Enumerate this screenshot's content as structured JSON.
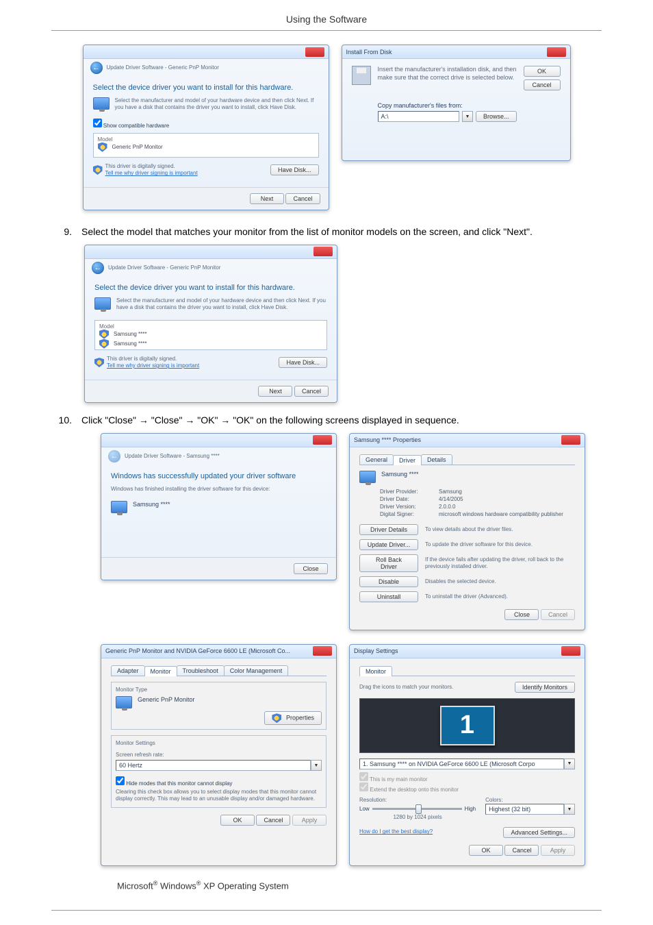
{
  "page_header": "Using the Software",
  "dialog_update_driver": {
    "title": "Update Driver Software - Generic PnP Monitor",
    "heading": "Select the device driver you want to install for this hardware.",
    "instruction": "Select the manufacturer and model of your hardware device and then click Next. If you have a disk that contains the driver you want to install, click Have Disk.",
    "show_compatible": "Show compatible hardware",
    "model_label": "Model",
    "model_item": "Generic PnP Monitor",
    "signed_text": "This driver is digitally signed.",
    "signing_link": "Tell me why driver signing is important",
    "have_disk_btn": "Have Disk...",
    "next_btn": "Next",
    "cancel_btn": "Cancel"
  },
  "dialog_install_from_disk": {
    "title": "Install From Disk",
    "instruction": "Insert the manufacturer's installation disk, and then make sure that the correct drive is selected below.",
    "ok_btn": "OK",
    "cancel_btn": "Cancel",
    "copy_label": "Copy manufacturer's files from:",
    "path_value": "A:\\",
    "browse_btn": "Browse..."
  },
  "step9": {
    "num": "9.",
    "text": "Select the model that matches your monitor from the list of monitor models on the screen, and click \"Next\"."
  },
  "dialog_update_driver_samsung": {
    "title": "Update Driver Software - Generic PnP Monitor",
    "heading": "Select the device driver you want to install for this hardware.",
    "instruction": "Select the manufacturer and model of your hardware device and then click Next. If you have a disk that contains the driver you want to install, click Have Disk.",
    "model_label": "Model",
    "model_item1": "Samsung ****",
    "model_item2": "Samsung ****",
    "signed_text": "This driver is digitally signed.",
    "signing_link": "Tell me why driver signing is important",
    "have_disk_btn": "Have Disk...",
    "next_btn": "Next",
    "cancel_btn": "Cancel"
  },
  "step10": {
    "num": "10.",
    "text": "Click \"Close\" → \"Close\" → \"OK\" → \"OK\" on the following screens displayed in sequence."
  },
  "dialog_success": {
    "title": "Update Driver Software - Samsung ****",
    "heading": "Windows has successfully updated your driver software",
    "sub": "Windows has finished installing the driver software for this device:",
    "device": "Samsung ****",
    "close_btn": "Close"
  },
  "dialog_props": {
    "title": "Samsung **** Properties",
    "tab_general": "General",
    "tab_driver": "Driver",
    "tab_details": "Details",
    "device_name": "Samsung ****",
    "provider_lbl": "Driver Provider:",
    "provider_val": "Samsung",
    "date_lbl": "Driver Date:",
    "date_val": "4/14/2005",
    "version_lbl": "Driver Version:",
    "version_val": "2.0.0.0",
    "signer_lbl": "Digital Signer:",
    "signer_val": "microsoft windows hardware compatibility publisher",
    "btn_details": "Driver Details",
    "btn_details_desc": "To view details about the driver files.",
    "btn_update": "Update Driver...",
    "btn_update_desc": "To update the driver software for this device.",
    "btn_rollback": "Roll Back Driver",
    "btn_rollback_desc": "If the device fails after updating the driver, roll back to the previously installed driver.",
    "btn_disable": "Disable",
    "btn_disable_desc": "Disables the selected device.",
    "btn_uninstall": "Uninstall",
    "btn_uninstall_desc": "To uninstall the driver (Advanced).",
    "close_btn": "Close",
    "cancel_btn": "Cancel"
  },
  "dialog_generic_monitor": {
    "title": "Generic PnP Monitor and NVIDIA GeForce 6600 LE (Microsoft Co...",
    "tab_adapter": "Adapter",
    "tab_monitor": "Monitor",
    "tab_troubleshoot": "Troubleshoot",
    "tab_color": "Color Management",
    "type_label": "Monitor Type",
    "type_value": "Generic PnP Monitor",
    "properties_btn": "Properties",
    "settings_label": "Monitor Settings",
    "refresh_label": "Screen refresh rate:",
    "refresh_value": "60 Hertz",
    "hide_modes": "Hide modes that this monitor cannot display",
    "hide_desc": "Clearing this check box allows you to select display modes that this monitor cannot display correctly. This may lead to an unusable display and/or damaged hardware.",
    "ok_btn": "OK",
    "cancel_btn": "Cancel",
    "apply_btn": "Apply"
  },
  "dialog_display_settings": {
    "title": "Display Settings",
    "tab_monitor": "Monitor",
    "drag_text": "Drag the icons to match your monitors.",
    "identify_btn": "Identify Monitors",
    "display_num": "1",
    "monitor_dropdown": "1. Samsung **** on NVIDIA GeForce 6600 LE (Microsoft Corpo",
    "main_monitor": "This is my main monitor",
    "extend_desktop": "Extend the desktop onto this monitor",
    "resolution_lbl": "Resolution:",
    "res_low": "Low",
    "res_high": "High",
    "res_value": "1280 by 1024 pixels",
    "colors_lbl": "Colors:",
    "colors_value": "Highest (32 bit)",
    "best_link": "How do I get the best display?",
    "advanced_btn": "Advanced Settings...",
    "ok_btn": "OK",
    "cancel_btn": "Cancel",
    "apply_btn": "Apply"
  },
  "footer_note_pre": "Microsoft",
  "footer_note_mid": " Windows",
  "footer_note_post": " XP Operating System"
}
